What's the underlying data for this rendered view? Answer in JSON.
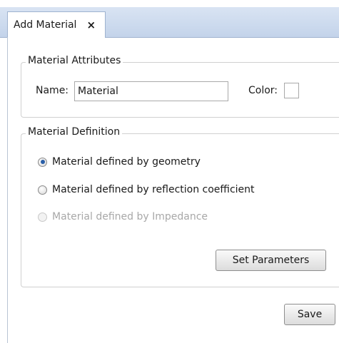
{
  "tab": {
    "title": "Add Material",
    "close_glyph": "×"
  },
  "attributes": {
    "legend": "Material Attributes",
    "name_label": "Name:",
    "name_value": "Material",
    "color_label": "Color:"
  },
  "definition": {
    "legend": "Material Definition",
    "options": [
      {
        "label": "Material defined by geometry",
        "checked": true,
        "enabled": true
      },
      {
        "label": "Material defined by reflection coefficient",
        "checked": false,
        "enabled": true
      },
      {
        "label": "Material defined by Impedance",
        "checked": false,
        "enabled": false
      }
    ],
    "set_parameters_label": "Set Parameters"
  },
  "footer": {
    "save_label": "Save"
  },
  "colors": {
    "tabstrip": "#c3d3ea",
    "radio_selected": "#2a5fa8",
    "disabled_text": "#a8a8a8"
  },
  "icons": {
    "tab_close": "close-icon"
  }
}
